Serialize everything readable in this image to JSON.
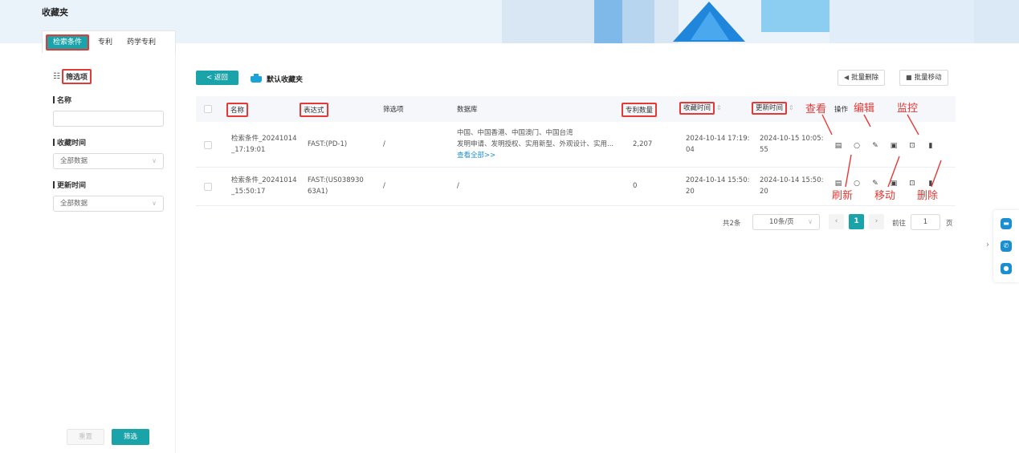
{
  "header": {
    "title": "收藏夹"
  },
  "tabs": [
    {
      "label": "检索条件",
      "active": true
    },
    {
      "label": "专利",
      "active": false
    },
    {
      "label": "药学专利",
      "active": false
    }
  ],
  "filter": {
    "title": "筛选项",
    "name_label": "名称",
    "name_value": "",
    "collect_time_label": "收藏时间",
    "collect_time_value": "全部数据",
    "update_time_label": "更新时间",
    "update_time_value": "全部数据",
    "reset_label": "重置",
    "filter_label": "筛选"
  },
  "toolbar": {
    "back_label": "< 返回",
    "folder_name": "默认收藏夹",
    "bulk_delete_label": "批量删除",
    "bulk_move_label": "批量移动"
  },
  "table": {
    "columns": {
      "name": "名称",
      "expression": "表达式",
      "filter_items": "筛选项",
      "database": "数据库",
      "patent_count": "专利数量",
      "collect_time": "收藏时间",
      "update_time": "更新时间",
      "actions": "操作"
    },
    "rows": [
      {
        "name_l1": "检索条件_20241014",
        "name_l2": "_17:19:01",
        "expression_l1": "FAST:(PD-1)",
        "expression_l2": "",
        "filter_items": "/",
        "db_l1": "中国、中国香港、中国澳门、中国台湾",
        "db_l2": "发明申请、发明授权、实用新型、外观设计、实用...",
        "db_more": "查看全部>>",
        "patent_count": "2,207",
        "collect_l1": "2024-10-14 17:19:",
        "collect_l2": "04",
        "update_l1": "2024-10-15 10:05:",
        "update_l2": "55"
      },
      {
        "name_l1": "检索条件_20241014",
        "name_l2": "_15:50:17",
        "expression_l1": "FAST:(US038930",
        "expression_l2": "63A1)",
        "filter_items": "/",
        "db_l1": "/",
        "db_l2": "",
        "db_more": "",
        "patent_count": "0",
        "collect_l1": "2024-10-14 15:50:",
        "collect_l2": "20",
        "update_l1": "2024-10-14 15:50:",
        "update_l2": "20"
      }
    ]
  },
  "annotations": {
    "view": "查看",
    "edit": "编辑",
    "monitor": "监控",
    "refresh": "刷新",
    "move": "移动",
    "delete": "删除"
  },
  "pagination": {
    "total": "共2条",
    "page_size": "10条/页",
    "current_page": "1",
    "goto_label": "前往",
    "goto_value": "1",
    "page_unit": "页"
  },
  "colors": {
    "accent": "#1aa3a8",
    "annotation": "#e53935",
    "link": "#1a8fd0"
  }
}
